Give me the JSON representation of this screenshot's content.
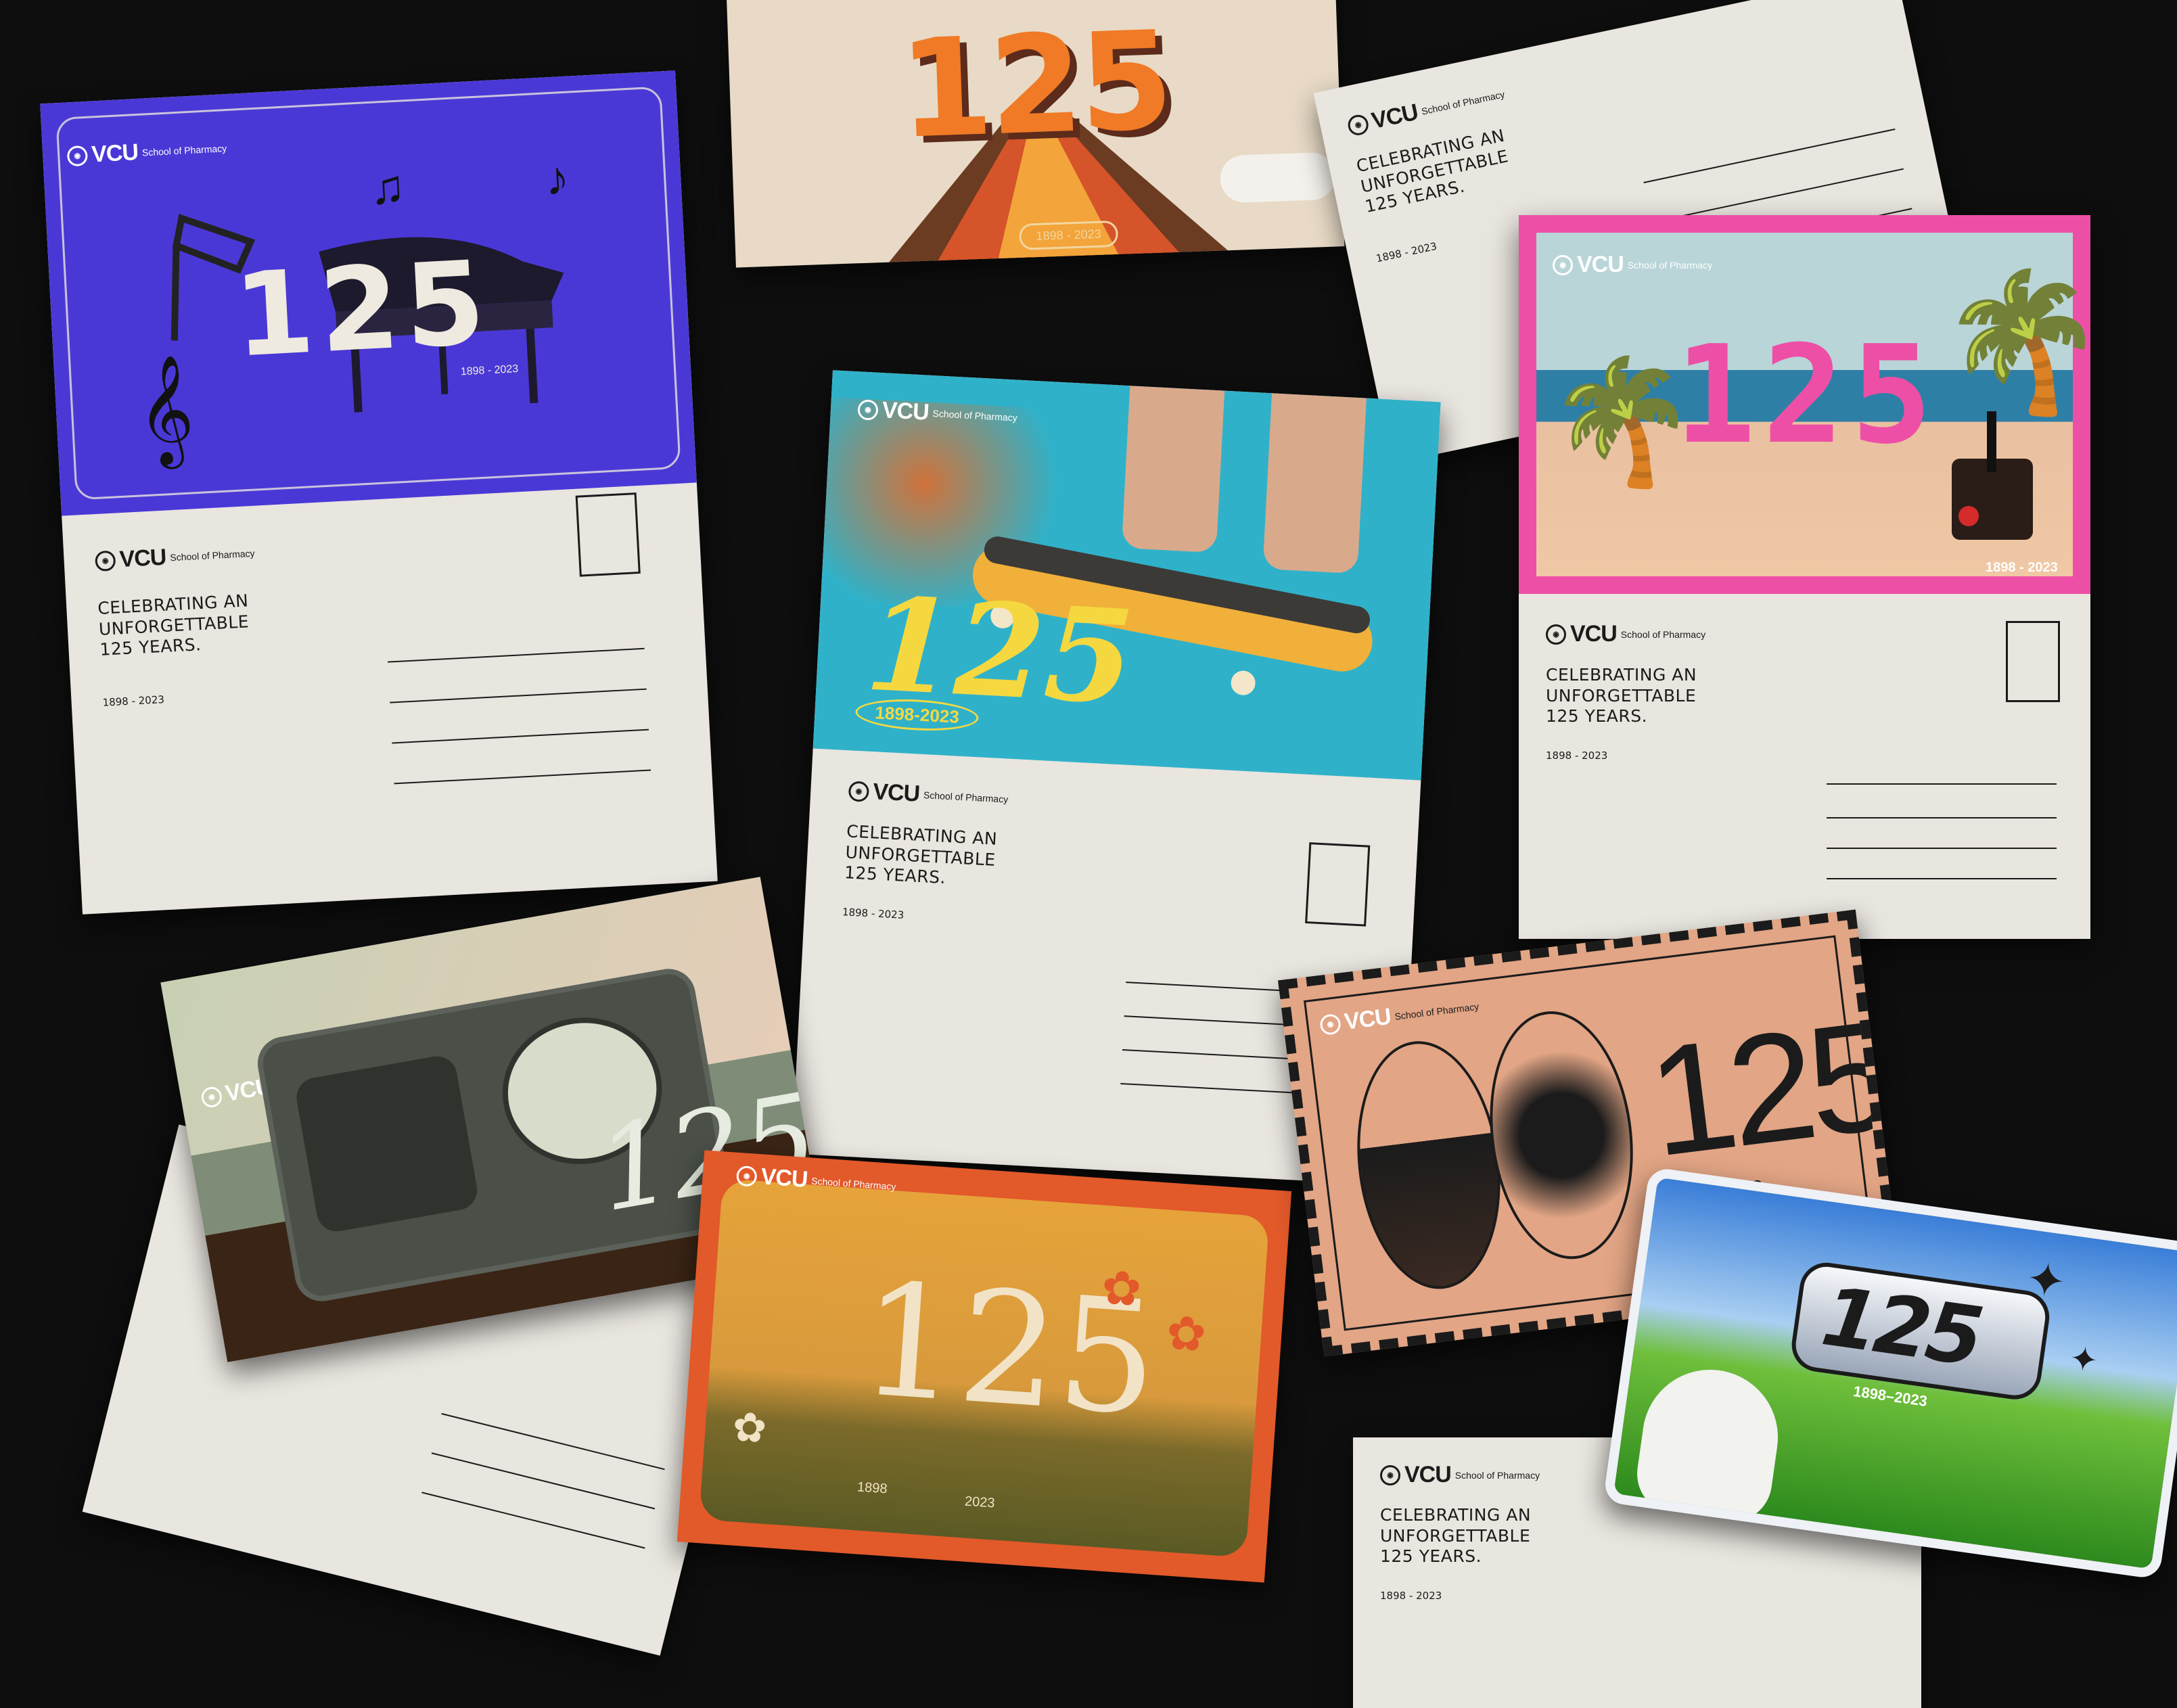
{
  "brand": {
    "logo_text": "VCU",
    "school_text": "School of Pharmacy"
  },
  "postcard_back": {
    "headline_line1": "CELEBRATING AN",
    "headline_line2": "UNFORGETTABLE",
    "headline_line3": "125 YEARS.",
    "years": "1898 - 2023"
  },
  "designs": {
    "number": "125",
    "years_compact": "1898 - 2023",
    "years_dash": "1898-2023",
    "years_double_dash": "1898–2023",
    "year_start": "1898",
    "year_end": "2023"
  },
  "colors": {
    "background": "#0e0e0e",
    "paper": "#e9e5df",
    "music_blue": "#4a38d6",
    "beach_pink": "#ee4fa6",
    "skate_teal": "#2fb2c9",
    "retro_orange": "#f07a26",
    "stamp_tan": "#e2a585",
    "flower_orange": "#e2592a"
  },
  "icons": [
    "music-note-icon",
    "piano-icon",
    "skateboard-icon",
    "palm-tree-icon",
    "joystick-icon",
    "radio-icon",
    "flower-icon",
    "computer-mouse-icon",
    "sparkle-icon"
  ]
}
